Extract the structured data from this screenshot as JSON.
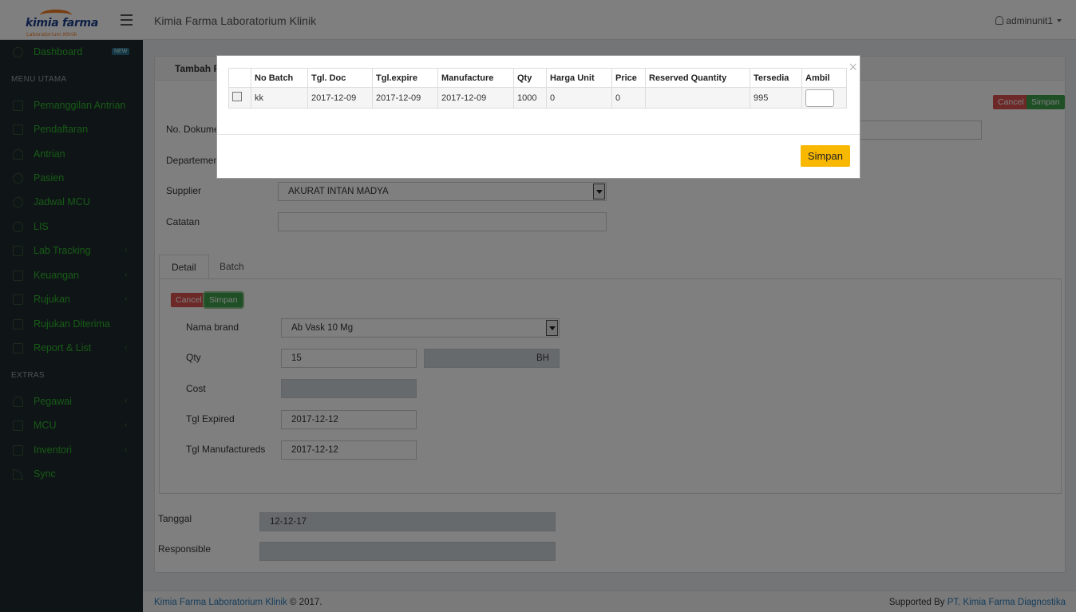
{
  "header": {
    "logo_text": "kimia farma",
    "logo_sub": "Laboratorium Klinik",
    "title": "Kimia Farma Laboratorium Klinik",
    "user": "adminunit1"
  },
  "sidebar": {
    "badge_new": "NEW",
    "head_main": "MENU UTAMA",
    "head_extras": "EXTRAS",
    "items": [
      {
        "label": "Dashboard",
        "icon": "dashboard-icon"
      },
      {
        "label": "Pemanggilan Antrian",
        "icon": "login-icon"
      },
      {
        "label": "Pendaftaran",
        "icon": "login-icon"
      },
      {
        "label": "Antrian",
        "icon": "user-icon"
      },
      {
        "label": "Pasien",
        "icon": "search-user-icon"
      },
      {
        "label": "Jadwal MCU",
        "icon": "clock-icon"
      },
      {
        "label": "LIS",
        "icon": "database-icon"
      },
      {
        "label": "Lab Tracking",
        "icon": "copy-icon"
      },
      {
        "label": "Keuangan",
        "icon": "money-icon"
      },
      {
        "label": "Rujukan",
        "icon": "folder-icon"
      },
      {
        "label": "Rujukan Diterima",
        "icon": "folder-icon"
      },
      {
        "label": "Report & List",
        "icon": "book-icon"
      },
      {
        "label": "Pegawai",
        "icon": "users-icon"
      },
      {
        "label": "MCU",
        "icon": "file-icon"
      },
      {
        "label": "Inventori",
        "icon": "file-icon"
      },
      {
        "label": "Sync",
        "icon": "rss-icon"
      }
    ]
  },
  "form": {
    "panel_title": "Tambah P",
    "cancel": "Cancel",
    "save": "Simpan",
    "no_dokumen_label": "No. Dokume",
    "departemen_label": "Departemen",
    "supplier_label": "Supplier",
    "supplier_value": "AKURAT INTAN MADYA",
    "catatan_label": "Catatan",
    "tab_detail": "Detail",
    "tab_batch": "Batch",
    "nama_brand_label": "Nama brand",
    "nama_brand_value": "Ab Vask 10 Mg",
    "qty_label": "Qty",
    "qty_value": "15",
    "qty_unit": "BH",
    "cost_label": "Cost",
    "tgl_expired_label": "Tgl Expired",
    "tgl_expired_value": "2017-12-12",
    "tgl_manufactureds_label": "Tgl Manufactureds",
    "tgl_manufactureds_value": "2017-12-12",
    "tanggal_label": "Tanggal",
    "tanggal_value": "12-12-17",
    "responsible_label": "Responsible"
  },
  "modal": {
    "close": "×",
    "columns": [
      "No Batch",
      "Tgl. Doc",
      "Tgl.expire",
      "Manufacture",
      "Qty",
      "Harga Unit",
      "Price",
      "Reserved Quantity",
      "Tersedia",
      "Ambil"
    ],
    "row": {
      "no_batch": "kk",
      "tgl_doc": "2017-12-09",
      "tgl_expire": "2017-12-09",
      "manufacture": "2017-12-09",
      "qty": "1000",
      "harga_unit": "0",
      "price": "0",
      "reserved": "",
      "tersedia": "995"
    },
    "save": "Simpan"
  },
  "footer": {
    "left_link": "Kimia Farma Laboratorium Klinik",
    "left_text": " © 2017.",
    "right_text": "Supported By ",
    "right_link": "PT. Kimia Farma Diagnostika"
  },
  "colors": {
    "sidebar_bg": "#1e2a2c",
    "sidebar_text": "#2fb52f",
    "modal_save": "#f8b800"
  }
}
